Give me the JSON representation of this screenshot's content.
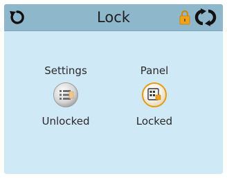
{
  "header": {
    "title": "Lock",
    "back_icon": "back-arrow-icon",
    "lock_icon": "padlock-icon",
    "refresh_icon": "refresh-icon"
  },
  "tiles": [
    {
      "label": "Settings",
      "status": "Unlocked",
      "icon": "settings-list-icon",
      "state": "unlocked"
    },
    {
      "label": "Panel",
      "status": "Locked",
      "icon": "panel-keypad-icon",
      "state": "locked"
    }
  ],
  "colors": {
    "header_bg": "#8fb7cc",
    "screen_bg": "#cfe9f6",
    "lock_accent": "#f0a31a"
  }
}
